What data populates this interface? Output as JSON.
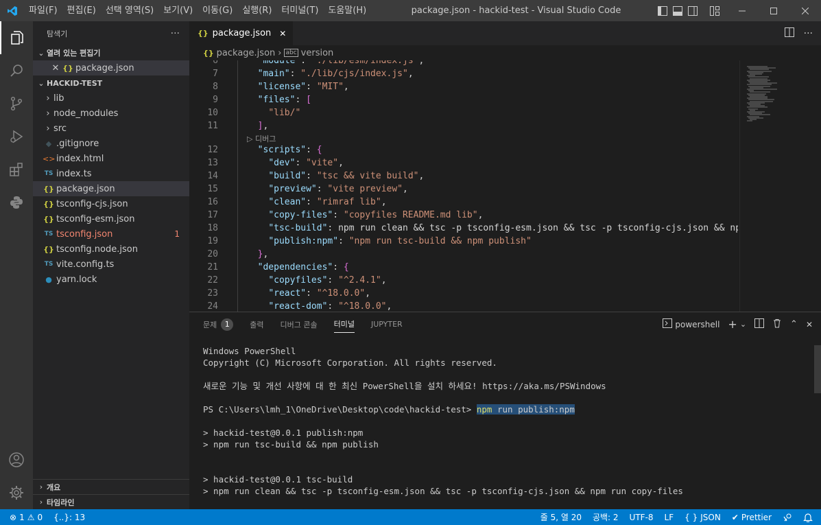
{
  "titlebar": {
    "menus": [
      "파일(F)",
      "편집(E)",
      "선택 영역(S)",
      "보기(V)",
      "이동(G)",
      "실행(R)",
      "터미널(T)",
      "도움말(H)"
    ],
    "title": "package.json - hackid-test - Visual Studio Code"
  },
  "sidebar": {
    "title": "탐색기",
    "more": "···",
    "open_editors_label": "열려 있는 편집기",
    "open_editor_file": "package.json",
    "project_label": "HACKID-TEST",
    "items": [
      {
        "label": "lib",
        "type": "folder"
      },
      {
        "label": "node_modules",
        "type": "folder"
      },
      {
        "label": "src",
        "type": "folder"
      },
      {
        "label": ".gitignore",
        "type": "git"
      },
      {
        "label": "index.html",
        "type": "html"
      },
      {
        "label": "index.ts",
        "type": "ts"
      },
      {
        "label": "package.json",
        "type": "json"
      },
      {
        "label": "tsconfig-cjs.json",
        "type": "json"
      },
      {
        "label": "tsconfig-esm.json",
        "type": "json"
      },
      {
        "label": "tsconfig.json",
        "type": "tsconfig",
        "badge": "1"
      },
      {
        "label": "tsconfig.node.json",
        "type": "json"
      },
      {
        "label": "vite.config.ts",
        "type": "ts"
      },
      {
        "label": "yarn.lock",
        "type": "yarn"
      }
    ],
    "outline_label": "개요",
    "timeline_label": "타임라인"
  },
  "editor": {
    "tab_label": "package.json",
    "breadcrumb_file": "package.json",
    "breadcrumb_symbol": "version",
    "codelens": "디버그",
    "lines": [
      {
        "n": "6",
        "text": "  \"module\": \"./lib/esm/index.js\","
      },
      {
        "n": "7",
        "text": "  \"main\": \"./lib/cjs/index.js\","
      },
      {
        "n": "8",
        "text": "  \"license\": \"MIT\","
      },
      {
        "n": "9",
        "text": "  \"files\": ["
      },
      {
        "n": "10",
        "text": "    \"lib/\""
      },
      {
        "n": "11",
        "text": "  ],"
      },
      {
        "n": "12",
        "text": "  \"scripts\": {"
      },
      {
        "n": "13",
        "text": "    \"dev\": \"vite\","
      },
      {
        "n": "14",
        "text": "    \"build\": \"tsc && vite build\","
      },
      {
        "n": "15",
        "text": "    \"preview\": \"vite preview\","
      },
      {
        "n": "16",
        "text": "    \"clean\": \"rimraf lib\","
      },
      {
        "n": "17",
        "text": "    \"copy-files\": \"copyfiles README.md lib\","
      },
      {
        "n": "18",
        "text": "    \"tsc-build\": \"npm run clean && tsc -p tsconfig-esm.json && tsc -p tsconfig-cjs.json && npm r"
      },
      {
        "n": "19",
        "text": "    \"publish:npm\": \"npm run tsc-build && npm publish\""
      },
      {
        "n": "20",
        "text": "  },"
      },
      {
        "n": "21",
        "text": "  \"dependencies\": {"
      },
      {
        "n": "22",
        "text": "    \"copyfiles\": \"^2.4.1\","
      },
      {
        "n": "23",
        "text": "    \"react\": \"^18.0.0\","
      },
      {
        "n": "24",
        "text": "    \"react-dom\": \"^18.0.0\","
      }
    ]
  },
  "panel": {
    "tabs": [
      {
        "label": "문제",
        "badge": "1"
      },
      {
        "label": "출력"
      },
      {
        "label": "디버그 콘솔"
      },
      {
        "label": "터미널",
        "active": true
      },
      {
        "label": "JUPYTER"
      }
    ],
    "shell": "powershell",
    "terminal": {
      "l1": "Windows PowerShell",
      "l2": "Copyright (C) Microsoft Corporation. All rights reserved.",
      "l3": "새로운 기능 및 개선 사항에 대 한 최신 PowerShell을 설치 하세요! https://aka.ms/PSWindows",
      "prompt": "PS C:\\Users\\lmh_1\\OneDrive\\Desktop\\code\\hackid-test> ",
      "cmd_word": "npm",
      "cmd_rest": " run publish:npm",
      "l5": "> hackid-test@0.0.1 publish:npm",
      "l6": "> npm run tsc-build && npm publish",
      "l7": "> hackid-test@0.0.1 tsc-build",
      "l8": "> npm run clean && tsc -p tsconfig-esm.json && tsc -p tsconfig-cjs.json && npm run copy-files"
    }
  },
  "statusbar": {
    "errors": "1",
    "warnings": "0",
    "json_count": "{..}: 13",
    "cursor": "줄 5, 열 20",
    "spaces": "공백: 2",
    "encoding": "UTF-8",
    "eol": "LF",
    "language": "JSON",
    "prettier": "Prettier"
  },
  "colors": {
    "statusbar": "#007acc",
    "activitybar": "#333333",
    "sidebar": "#252526",
    "editor": "#1e1e1e"
  }
}
